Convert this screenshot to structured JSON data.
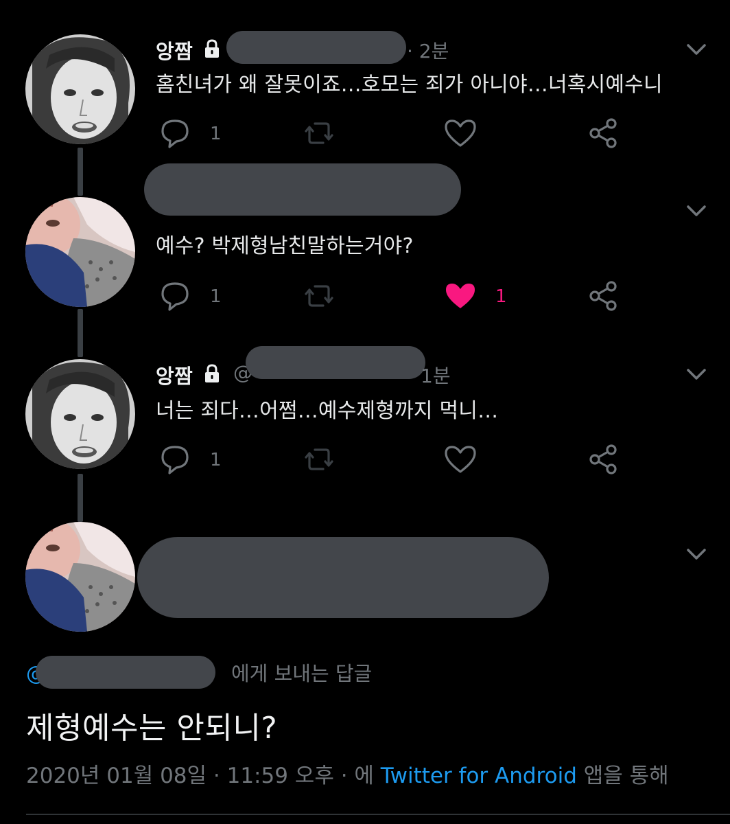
{
  "tweets": [
    {
      "name": "앙짬",
      "time": "· 2분",
      "text": "홈친녀가 왜 잘못이죠…호모는 죄가 아니야…너혹시예수니",
      "reply_count": "1",
      "like_count": ""
    },
    {
      "name": "",
      "time": "",
      "text": "예수? 박제형남친말하는거야?",
      "reply_count": "1",
      "like_count": "1"
    },
    {
      "name": "앙짬",
      "handle_prefix": "@",
      "time": "1분",
      "text": "너는 죄다…어쩜…예수제형까지 먹니…",
      "reply_count": "1",
      "like_count": ""
    }
  ],
  "main": {
    "reply_at": "@",
    "reply_suffix": "에게 보내는 답글",
    "text": "제형예수는 안되니?",
    "date": "2020년 01월 08일 · 11:59 오후 · 에 ",
    "source": "Twitter for Android",
    "source_suffix": " 앱을 통해"
  },
  "colors": {
    "background": "#000000",
    "link": "#1d9bf0",
    "like_active": "#f91880",
    "muted": "#71767b"
  },
  "icons": [
    "lock-icon",
    "chevron-down-icon",
    "reply-icon",
    "retweet-icon",
    "like-icon",
    "share-icon"
  ]
}
